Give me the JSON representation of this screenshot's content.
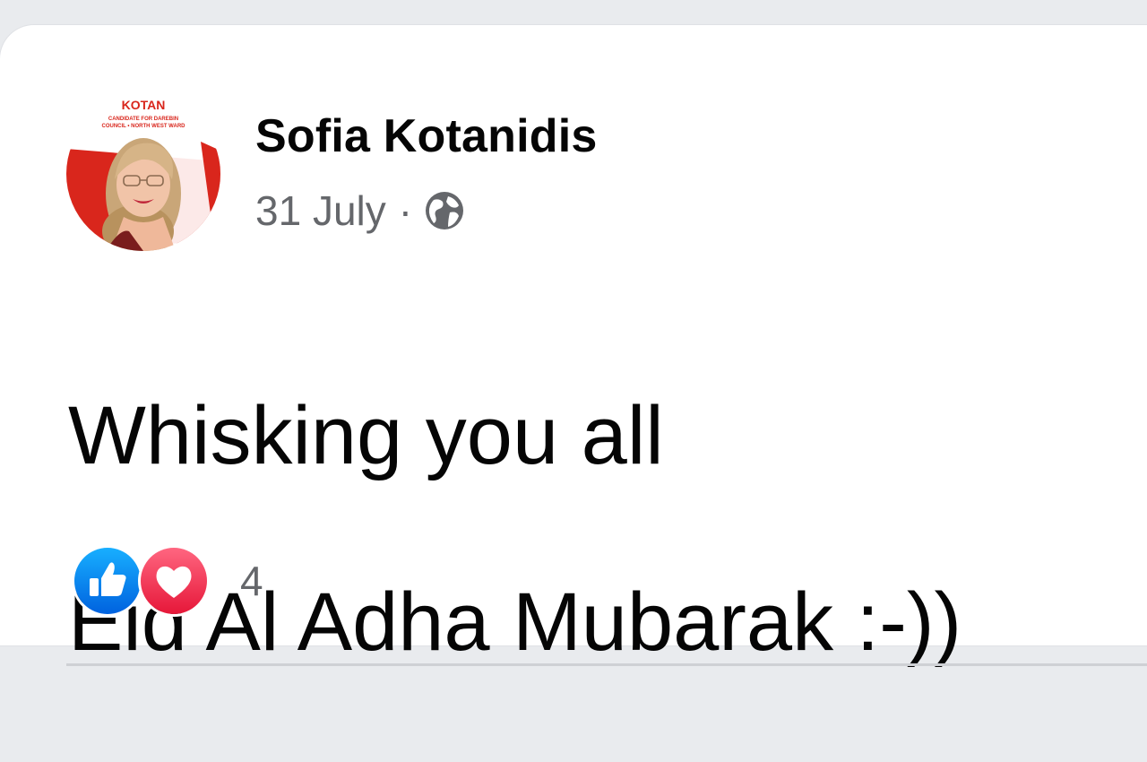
{
  "post": {
    "author": "Sofia Kotanidis",
    "date": "31 July",
    "separator": "·",
    "audience_icon": "globe-icon",
    "text_lines": [
      "Whisking you all",
      "Eid Al Adha Mubarak :-))"
    ],
    "avatar": {
      "banner_top": "KOTAN",
      "banner_line1": "CANDIDATE FOR DAREBIN",
      "banner_line2": "COUNCIL • NORTH WEST WARD"
    }
  },
  "reactions": {
    "icons": [
      "like-icon",
      "love-icon"
    ],
    "count": "4"
  },
  "colors": {
    "like": "#1877f2",
    "love": "#f33e58",
    "text_secondary": "#65676b",
    "banner_red": "#d9261c"
  }
}
